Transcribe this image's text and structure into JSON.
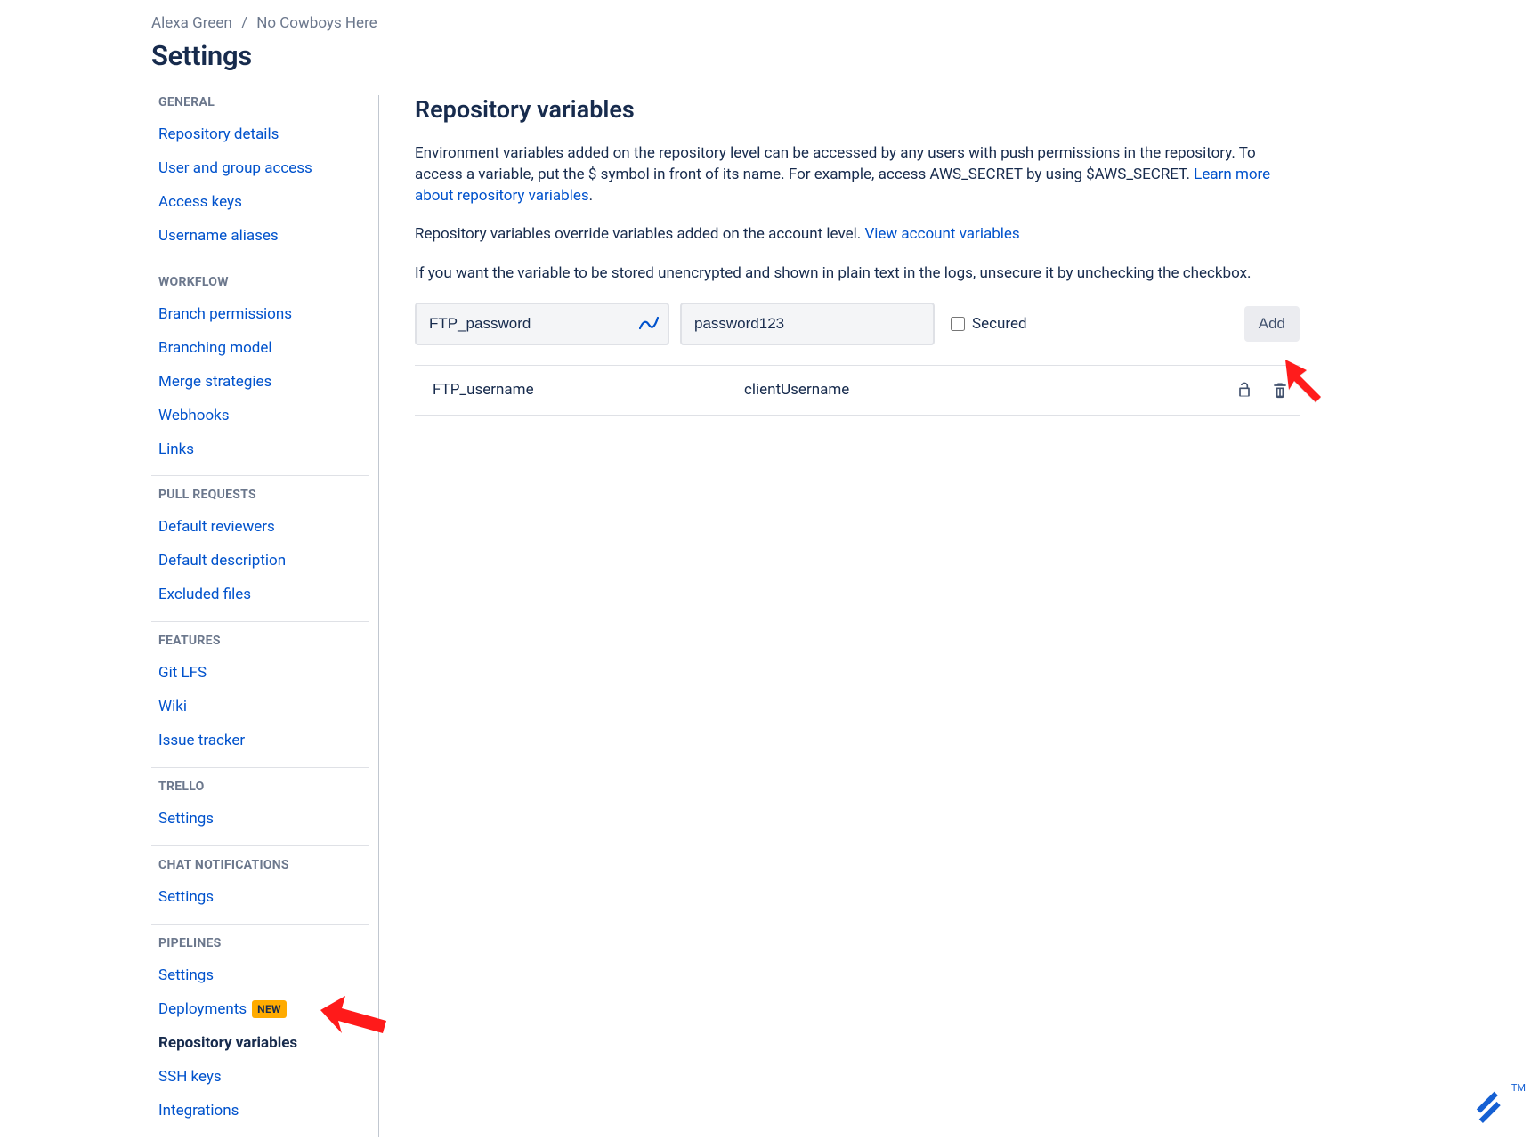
{
  "breadcrumb": {
    "owner": "Alexa Green",
    "repo": "No Cowboys Here"
  },
  "page_title": "Settings",
  "sidebar": {
    "groups": [
      {
        "label": "GENERAL",
        "items": [
          {
            "label": "Repository details"
          },
          {
            "label": "User and group access"
          },
          {
            "label": "Access keys"
          },
          {
            "label": "Username aliases"
          }
        ]
      },
      {
        "label": "WORKFLOW",
        "items": [
          {
            "label": "Branch permissions"
          },
          {
            "label": "Branching model"
          },
          {
            "label": "Merge strategies"
          },
          {
            "label": "Webhooks"
          },
          {
            "label": "Links"
          }
        ]
      },
      {
        "label": "PULL REQUESTS",
        "items": [
          {
            "label": "Default reviewers"
          },
          {
            "label": "Default description"
          },
          {
            "label": "Excluded files"
          }
        ]
      },
      {
        "label": "FEATURES",
        "items": [
          {
            "label": "Git LFS"
          },
          {
            "label": "Wiki"
          },
          {
            "label": "Issue tracker"
          }
        ]
      },
      {
        "label": "TRELLO",
        "items": [
          {
            "label": "Settings"
          }
        ]
      },
      {
        "label": "CHAT NOTIFICATIONS",
        "items": [
          {
            "label": "Settings"
          }
        ]
      },
      {
        "label": "PIPELINES",
        "items": [
          {
            "label": "Settings"
          },
          {
            "label": "Deployments",
            "badge": "NEW"
          },
          {
            "label": "Repository variables",
            "active": true
          },
          {
            "label": "SSH keys"
          },
          {
            "label": "Integrations"
          }
        ]
      }
    ]
  },
  "main": {
    "title": "Repository variables",
    "desc1_a": "Environment variables added on the repository level can be accessed by any users with push permissions in the repository. To access a variable, put the $ symbol in front of its name. For example, access AWS_SECRET by using $AWS_SECRET. ",
    "desc1_link": "Learn more about repository variables",
    "desc2_a": "Repository variables override variables added on the account level. ",
    "desc2_link": "View account variables",
    "desc3": "If you want the variable to be stored unencrypted and shown in plain text in the logs, unsecure it by unchecking the checkbox.",
    "form": {
      "name_value": "FTP_password",
      "value_value": "password123",
      "secured_label": "Secured",
      "add_label": "Add"
    },
    "rows": [
      {
        "name": "FTP_username",
        "value": "clientUsername"
      }
    ]
  },
  "corner_tm": "TM"
}
